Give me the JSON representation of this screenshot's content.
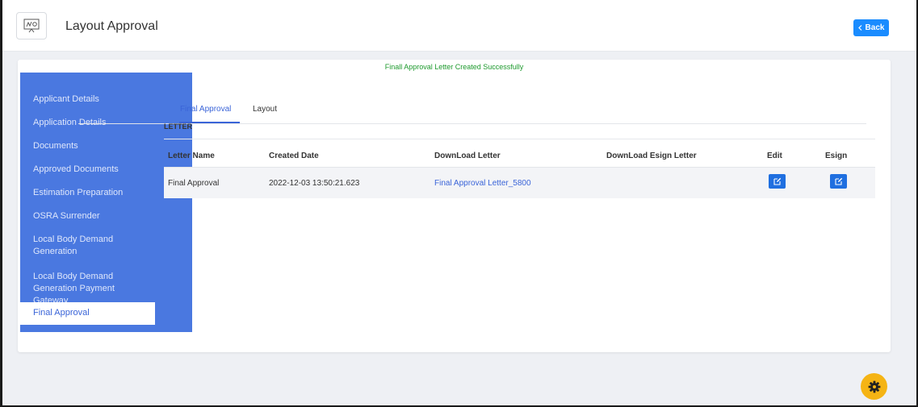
{
  "header": {
    "title": "Layout Approval",
    "back_label": "Back"
  },
  "notification": {
    "message": "Finall Approval Letter Created Successfully",
    "color": "#1e9a2e"
  },
  "sidebar": {
    "items": [
      {
        "label": "Applicant Details"
      },
      {
        "label": "Application Details"
      },
      {
        "label": "Documents"
      },
      {
        "label": "Approved Documents"
      },
      {
        "label": "Estimation Preparation"
      },
      {
        "label": "OSRA Surrender"
      },
      {
        "label": "Local Body Demand Generation"
      },
      {
        "label": "Local Body Demand Generation Payment Gateway"
      },
      {
        "label": "Final Approval",
        "active": true
      }
    ]
  },
  "tabs": [
    {
      "label": "Final Approval",
      "active": true
    },
    {
      "label": "Layout"
    }
  ],
  "section": {
    "title": "LETTER"
  },
  "table": {
    "headers": [
      "Letter Name",
      "Created Date",
      "DownLoad Letter",
      "DownLoad Esign Letter",
      "Edit",
      "Esign"
    ],
    "rows": [
      {
        "letter_name": "Final Approval",
        "created_date": "2022-12-03 13:50:21.623",
        "download_letter": "Final Approval Letter_5800",
        "download_esign_letter": ""
      }
    ]
  },
  "icons": {
    "logo": "layout-document-icon",
    "back": "chevron-left-icon",
    "edit": "edit-icon",
    "esign": "edit-icon",
    "settings": "gear-icon"
  },
  "colors": {
    "primary": "#3a64d8",
    "sidebar": "#4a78e0",
    "back_button": "#1a8cff",
    "fab": "#f5b414"
  }
}
